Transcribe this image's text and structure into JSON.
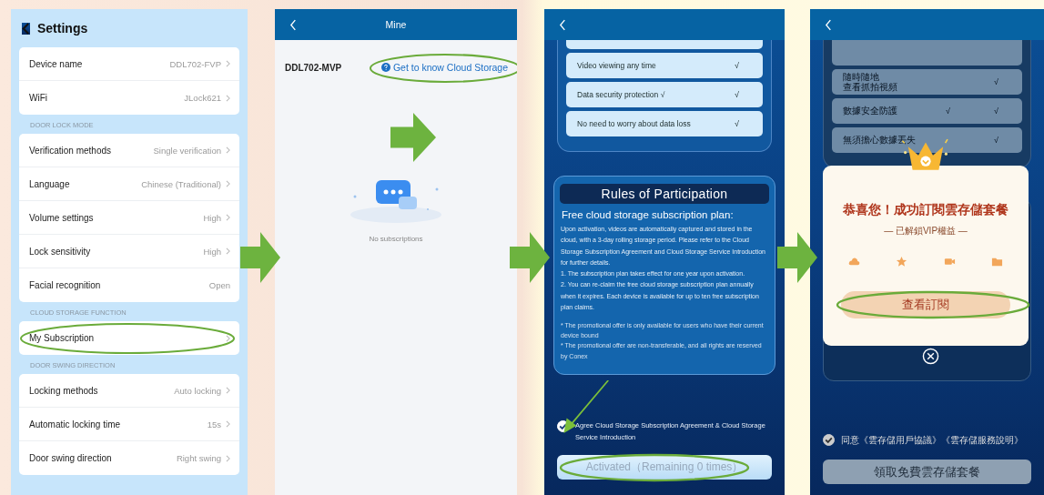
{
  "settings": {
    "title": "Settings",
    "groups": [
      {
        "items": [
          {
            "label": "Device name",
            "value": "DDL702-FVP",
            "chevron": true,
            "highlighted": false
          },
          {
            "label": "WiFi",
            "value": "JLock621",
            "chevron": true,
            "highlighted": false
          }
        ]
      },
      {
        "header": "DOOR LOCK MODE",
        "items": [
          {
            "label": "Verification methods",
            "value": "Single verification",
            "chevron": true,
            "highlighted": false
          },
          {
            "label": "Language",
            "value": "Chinese (Traditional)",
            "chevron": true,
            "highlighted": false
          },
          {
            "label": "Volume settings",
            "value": "High",
            "chevron": true,
            "highlighted": false
          },
          {
            "label": "Lock sensitivity",
            "value": "High",
            "chevron": true,
            "highlighted": false
          },
          {
            "label": "Facial recognition",
            "value": "Open",
            "chevron": false,
            "highlighted": false
          }
        ]
      },
      {
        "header": "CLOUD STORAGE FUNCTION",
        "items": [
          {
            "label": "My Subscription",
            "chevron": true,
            "highlighted": true
          }
        ]
      },
      {
        "header": "DOOR SWING DIRECTION",
        "items": [
          {
            "label": "Locking methods",
            "value": "Auto locking",
            "chevron": true,
            "highlighted": false
          },
          {
            "label": "Automatic locking time",
            "value": "15s",
            "chevron": true,
            "highlighted": false
          },
          {
            "label": "Door swing direction",
            "value": "Right swing",
            "chevron": true,
            "highlighted": false
          }
        ]
      }
    ]
  },
  "mine": {
    "title": "Mine",
    "device": "DDL702-MVP",
    "link": {
      "label": "Get to know Cloud Storage",
      "highlighted": true
    },
    "empty": "No subscriptions"
  },
  "plan_en": {
    "features": [
      {
        "lines": [
          "Video viewing any time"
        ],
        "marks": [
          "√"
        ]
      },
      {
        "lines": [
          "Data security protection  √"
        ],
        "marks": [
          "√"
        ]
      },
      {
        "lines": [
          "No need to worry about data loss"
        ],
        "marks": [
          "√"
        ]
      }
    ],
    "rules_title": "Rules of Participation",
    "plan_title": "Free cloud storage subscription plan:",
    "paragraphs": [
      "Upon activation, videos are automatically captured and stored in the cloud, with a 3-day rolling storage period. Please refer to the Cloud Storage Subscription Agreement and Cloud Storage Service Introduction for further details.",
      "1. The subscription plan takes effect for one year upon activation.",
      "2. You can re-claim the free cloud storage subscription plan annually when it expires. Each device is available for up to ten free subscription plan claims."
    ],
    "notes": [
      "* The promotional offer is only available for users who have their current device bound",
      "* The promotional offer are non-transferable, and all rights are reserved by Conex"
    ],
    "agree": {
      "text": "Agree Cloud Storage Subscription Agreement & Cloud Storage Service Introduction",
      "checked": true,
      "pointed": true
    },
    "button": {
      "label": "Activated（Remaining 0 times）",
      "highlighted": true
    }
  },
  "plan_zh": {
    "features": [
      {
        "lines": [
          "隨時隨地",
          "查看抓拍視頻"
        ],
        "marks": [
          "√"
        ]
      },
      {
        "lines": [
          "數據安全防護"
        ],
        "marks": [
          "√",
          "√"
        ]
      },
      {
        "lines": [
          "無須擔心數據丟失"
        ],
        "marks": [
          "√"
        ]
      }
    ],
    "agree": {
      "text": "同意《雲存儲用戶協議》《雲存儲服務說明》",
      "checked": true
    },
    "button": {
      "label": "領取免費雲存儲套餐"
    },
    "popup": {
      "title": "恭喜您！成功訂閱雲存儲套餐",
      "subtitle": "— 已解鎖VIP權益 —",
      "button": {
        "label": "查看訂閱",
        "highlighted": true
      }
    }
  }
}
